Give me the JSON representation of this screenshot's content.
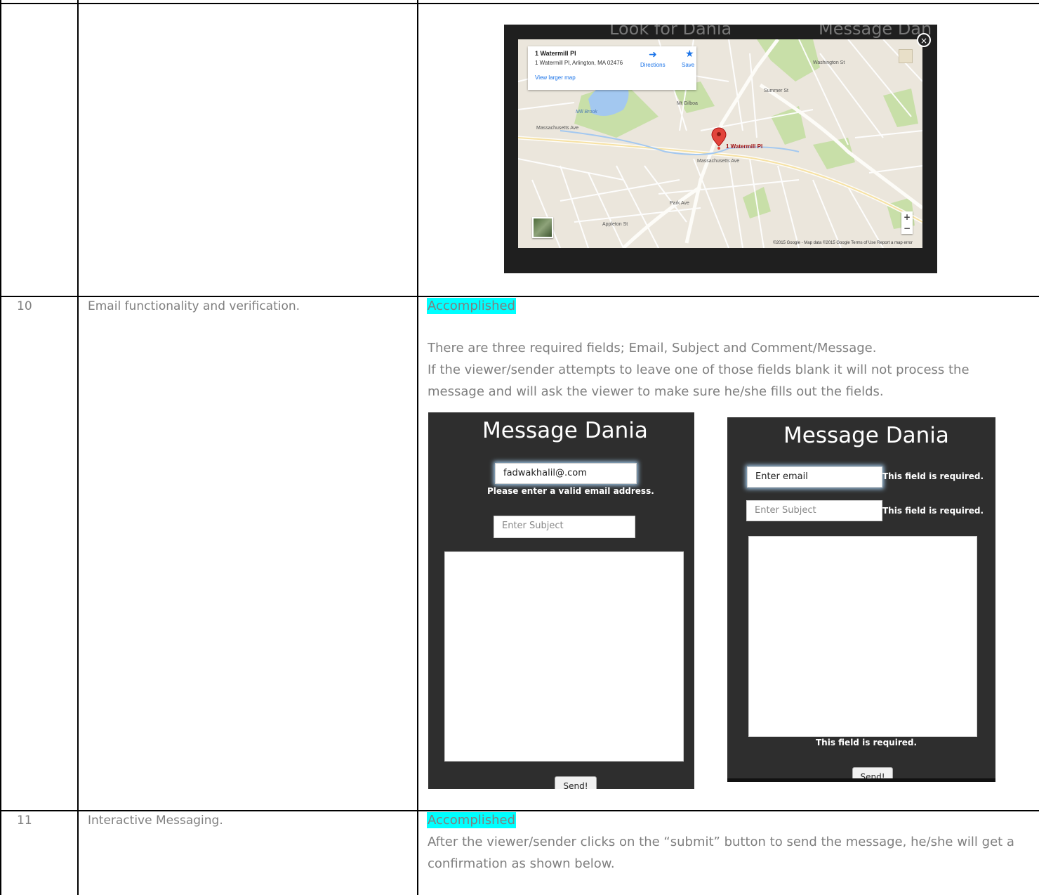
{
  "rows": [
    {
      "num": "10",
      "requirement": "Email functionality and verification.",
      "status": "Accomplished",
      "para": [
        "There are three required fields; Email, Subject and Comment/Message.",
        "If the viewer/sender attempts to leave one of those fields blank it will not process the",
        "message and will ask the viewer to make sure he/she fills out the fields."
      ]
    },
    {
      "num": "11",
      "requirement": "Interactive Messaging.",
      "status": "Accomplished",
      "para": [
        "After the viewer/sender clicks on the “submit” button to send the message, he/she will get a",
        "confirmation as shown below."
      ]
    }
  ],
  "map": {
    "bg_title_left": "Look for Dania",
    "bg_title_right": "Message Dan",
    "place_name": "1 Watermill Pl",
    "address": "1 Watermill Pl, Arlington, MA 02476",
    "view_larger": "View larger map",
    "directions": "Directions",
    "save": "Save",
    "pin_label": "1 Watermill Pl",
    "footer": "©2015 Google - Map data ©2015 Google   Terms of Use   Report a map error",
    "zoom_in": "+",
    "zoom_out": "−",
    "close": "×",
    "roads": {
      "massachusetts_ave": "Massachusetts Ave",
      "mill_brook": "Mill Brook",
      "mt_gilboa": "Mt Gilboa",
      "park_ave": "Park Ave",
      "appleton": "Appleton St",
      "summer": "Summer St",
      "washington": "Washington St"
    }
  },
  "form_a": {
    "title": "Message Dania",
    "email_value": "fadwakhalil@.com",
    "email_error": "Please enter a valid email address.",
    "subject_placeholder": "Enter Subject",
    "send_label": "Send!"
  },
  "form_b": {
    "title": "Message Dania",
    "email_placeholder": "Enter email",
    "subject_placeholder": "Enter Subject",
    "required_msg": "This field is required.",
    "send_label": "Send!"
  }
}
